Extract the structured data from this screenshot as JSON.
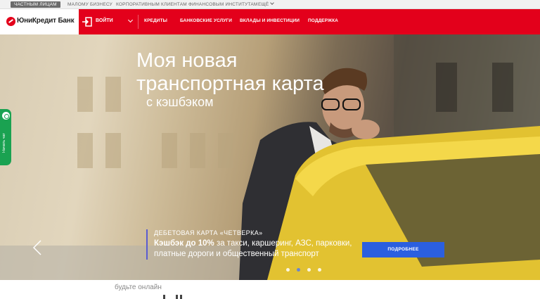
{
  "segments": [
    {
      "label": "Частным лицам",
      "active": true
    },
    {
      "label": "Малому бизнесу",
      "active": false
    },
    {
      "label": "Корпоративным клиентам",
      "active": false
    },
    {
      "label": "Финансовым институтам",
      "active": false
    },
    {
      "label": "Ещё",
      "active": false
    }
  ],
  "brand": {
    "name": "ЮниКредит Банк",
    "color": "#e3001b"
  },
  "nav": {
    "login_label": "Войти",
    "items": [
      "Кредиты",
      "Банковские услуги",
      "Вклады и инвестиции",
      "Поддержка"
    ]
  },
  "hero": {
    "title_line1": "Моя новая",
    "title_line2": "транспортная карта",
    "subtitle": "с кэшбэком",
    "card_label": "Дебетовая карта «Четверка»",
    "desc_bold": "Кэшбэк до 10%",
    "desc_rest": " за такси, каршеринг, АЗС, парковки,",
    "desc_line2": "платные дороги и общественный транспорт",
    "button_label": "Подробнее",
    "button_color": "#2b5fe0",
    "slide_count": 4,
    "active_slide": 2
  },
  "chat": {
    "label": "Начать чат",
    "color": "#1aa251"
  },
  "below": {
    "title": "будьте онлайн"
  }
}
